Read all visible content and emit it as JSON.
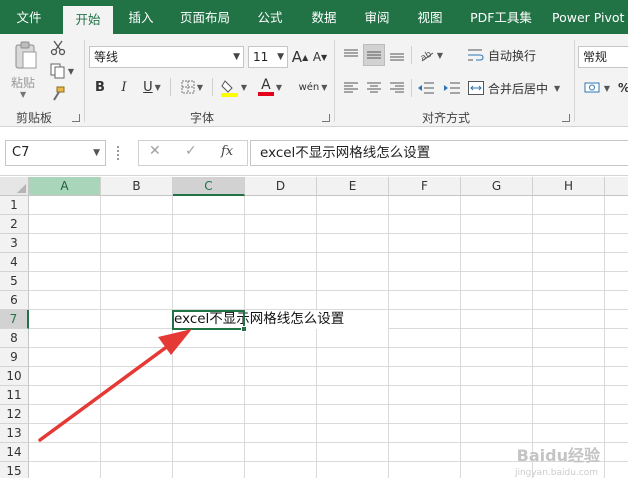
{
  "tabs": [
    {
      "label": "文件",
      "active": false
    },
    {
      "label": "开始",
      "active": true
    },
    {
      "label": "插入",
      "active": false
    },
    {
      "label": "页面布局",
      "active": false
    },
    {
      "label": "公式",
      "active": false
    },
    {
      "label": "数据",
      "active": false
    },
    {
      "label": "审阅",
      "active": false
    },
    {
      "label": "视图",
      "active": false
    },
    {
      "label": "PDF工具集",
      "active": false
    },
    {
      "label": "Power Pivot",
      "active": false
    }
  ],
  "ribbon": {
    "clipboard": {
      "label": "剪贴板",
      "paste_label": "粘贴"
    },
    "font": {
      "label": "字体",
      "font_name": "等线",
      "font_size": "11",
      "bold": "B",
      "italic": "I",
      "underline": "U",
      "grow": "A",
      "shrink": "A",
      "font_color_letter": "A",
      "phonetic": "wén"
    },
    "alignment": {
      "label": "对齐方式",
      "wrap_text": "自动换行",
      "merge_center": "合并后居中"
    },
    "number": {
      "format": "常规"
    }
  },
  "formula_bar": {
    "name_box": "C7",
    "cancel": "✕",
    "enter": "✓",
    "fx": "fx",
    "content": "excel不显示网格线怎么设置"
  },
  "sheet": {
    "columns": [
      "A",
      "B",
      "C",
      "D",
      "E",
      "F",
      "G",
      "H"
    ],
    "rows": [
      "1",
      "2",
      "3",
      "4",
      "5",
      "6",
      "7",
      "8",
      "9",
      "10",
      "11",
      "12",
      "13",
      "14",
      "15"
    ],
    "selected_cell": "C7",
    "c7_text": "excel不显示网格线怎么设置"
  },
  "colors": {
    "accent": "#217346",
    "arrow": "#e53935"
  },
  "watermark": {
    "text": "Baidu经验",
    "sub": "jingyan.baidu.com"
  }
}
